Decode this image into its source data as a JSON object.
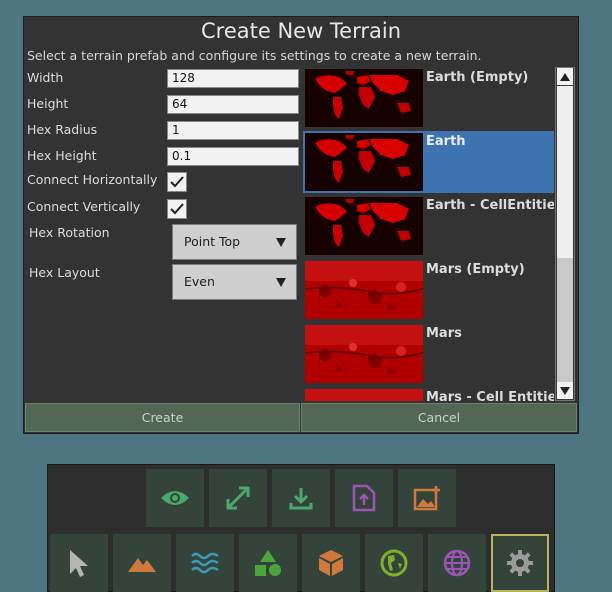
{
  "dialog": {
    "title": "Create New Terrain",
    "subtitle": "Select a terrain prefab and configure its settings to create a new terrain.",
    "fields": {
      "width_label": "Width",
      "width_value": "128",
      "height_label": "Height",
      "height_value": "64",
      "hex_radius_label": "Hex Radius",
      "hex_radius_value": "1",
      "hex_height_label": "Hex Height",
      "hex_height_value": "0.1",
      "connect_h_label": "Connect Horizontally",
      "connect_h_checked": true,
      "connect_v_label": "Connect Vertically",
      "connect_v_checked": true,
      "hex_rotation_label": "Hex Rotation",
      "hex_rotation_value": "Point Top",
      "hex_layout_label": "Hex Layout",
      "hex_layout_value": "Even"
    },
    "prefabs": [
      {
        "label": "Earth (Empty)",
        "map": "earth",
        "selected": false
      },
      {
        "label": "Earth",
        "map": "earth",
        "selected": true
      },
      {
        "label": "Earth - CellEntities",
        "map": "earth",
        "selected": false
      },
      {
        "label": "Mars (Empty)",
        "map": "mars",
        "selected": false
      },
      {
        "label": "Mars",
        "map": "mars",
        "selected": false
      },
      {
        "label": "Mars - Cell Entities",
        "map": "mars",
        "selected": false
      }
    ],
    "create_label": "Create",
    "cancel_label": "Cancel"
  },
  "toolbar": {
    "top_row": [
      {
        "icon": "eye-icon",
        "color": "#49a86a"
      },
      {
        "icon": "expand-icon",
        "color": "#49a86a"
      },
      {
        "icon": "download-icon",
        "color": "#49a86a"
      },
      {
        "icon": "file-upload-icon",
        "color": "#9a55b5"
      },
      {
        "icon": "add-image-icon",
        "color": "#d0793c"
      }
    ],
    "bottom_row": [
      {
        "icon": "pointer-icon",
        "color": "#b5b5b5"
      },
      {
        "icon": "mountain-icon",
        "color": "#d0793c"
      },
      {
        "icon": "water-icon",
        "color": "#3a9ab8"
      },
      {
        "icon": "shapes-icon",
        "color": "#4aa63a"
      },
      {
        "icon": "cube-icon",
        "color": "#d0793c"
      },
      {
        "icon": "earth-icon",
        "color": "#7fb02c"
      },
      {
        "icon": "globe-icon",
        "color": "#9a55b5"
      },
      {
        "icon": "gear-icon",
        "color": "#9a9a9a",
        "active": true
      }
    ]
  }
}
